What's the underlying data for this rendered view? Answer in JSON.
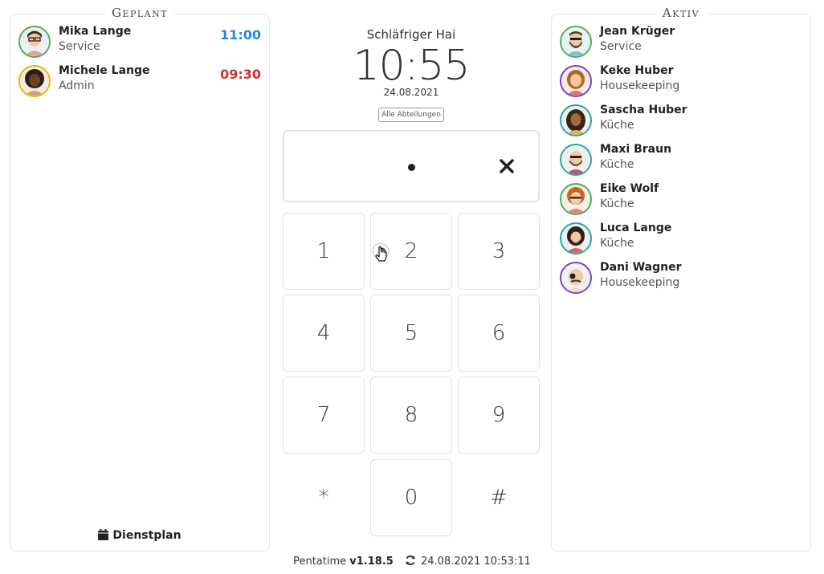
{
  "planned": {
    "title": "Geplant",
    "people": [
      {
        "name": "Mika Lange",
        "dept": "Service",
        "time": "11:00",
        "time_color": "#1e88e5"
      },
      {
        "name": "Michele Lange",
        "dept": "Admin",
        "time": "09:30",
        "time_color": "#d32f2f"
      }
    ],
    "schedule_link": "Dienstplan"
  },
  "center": {
    "device_name": "Schläfriger Hai",
    "clock": "10:55",
    "date": "24.08.2021",
    "dept_filter": "Alle Abteilungen",
    "keys": [
      "1",
      "2",
      "3",
      "4",
      "5",
      "6",
      "7",
      "8",
      "9",
      "*",
      "0",
      "#"
    ]
  },
  "active": {
    "title": "Aktiv",
    "people": [
      {
        "name": "Jean Krüger",
        "dept": "Service"
      },
      {
        "name": "Keke Huber",
        "dept": "Housekeeping"
      },
      {
        "name": "Sascha Huber",
        "dept": "Küche"
      },
      {
        "name": "Maxi Braun",
        "dept": "Küche"
      },
      {
        "name": "Eike Wolf",
        "dept": "Küche"
      },
      {
        "name": "Luca Lange",
        "dept": "Küche"
      },
      {
        "name": "Dani Wagner",
        "dept": "Housekeeping"
      }
    ]
  },
  "footer": {
    "app": "Pentatime",
    "version": "v1.18.5",
    "last_sync": "24.08.2021 10:53:11"
  },
  "icons": {
    "schedule": "calendar-icon",
    "sync": "refresh-icon",
    "clear": "close-icon",
    "cursor": "hand-pointer-icon"
  }
}
